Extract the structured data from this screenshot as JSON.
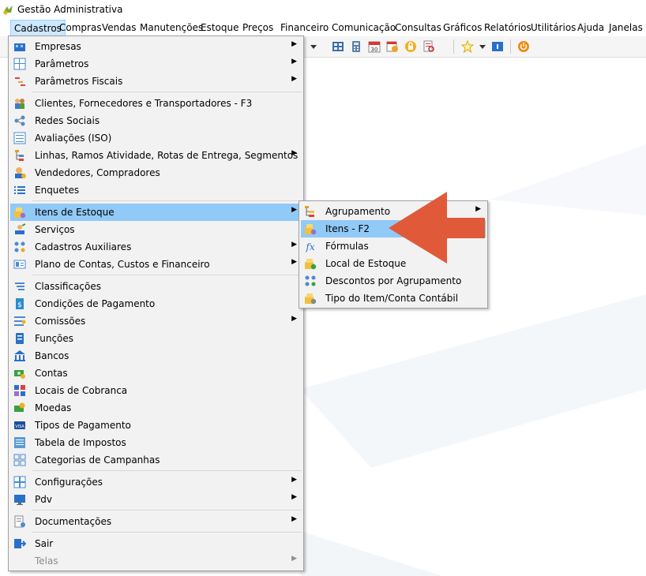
{
  "window": {
    "title": "Gestão Administrativa"
  },
  "menubar": [
    "Cadastros",
    "Compras",
    "Vendas",
    "Manutenções",
    "Estoque",
    "Preços",
    "Financeiro",
    "Comunicação",
    "Consultas",
    "Gráficos",
    "Relatórios",
    "Utilitários",
    "Ajuda",
    "Janelas"
  ],
  "main_menu": {
    "groups": [
      [
        {
          "label": "Empresas",
          "icon": "company-icon",
          "submenu": true
        },
        {
          "label": "Parâmetros",
          "icon": "parameters-icon",
          "submenu": true
        },
        {
          "label": "Parâmetros Fiscais",
          "icon": "fiscal-parameters-icon",
          "submenu": true
        }
      ],
      [
        {
          "label": "Clientes, Fornecedores e Transportadores - F3",
          "icon": "people-icon",
          "submenu": false
        },
        {
          "label": "Redes Sociais",
          "icon": "social-network-icon",
          "submenu": false
        },
        {
          "label": "Avaliações (ISO)",
          "icon": "evaluation-icon",
          "submenu": false
        },
        {
          "label": "Linhas, Ramos Atividade, Rotas de Entrega, Segmentos",
          "icon": "tree-icon",
          "submenu": true
        },
        {
          "label": "Vendedores, Compradores",
          "icon": "seller-icon",
          "submenu": false
        },
        {
          "label": "Enquetes",
          "icon": "list-icon",
          "submenu": false
        }
      ],
      [
        {
          "label": "Itens de Estoque",
          "icon": "stock-items-icon",
          "submenu": true,
          "highlighted": true
        },
        {
          "label": "Serviços",
          "icon": "services-icon",
          "submenu": false
        },
        {
          "label": "Cadastros Auxiliares",
          "icon": "auxiliary-icon",
          "submenu": true
        },
        {
          "label": "Plano de Contas, Custos e Financeiro",
          "icon": "accounts-plan-icon",
          "submenu": true
        }
      ],
      [
        {
          "label": "Classificações",
          "icon": "classification-icon",
          "submenu": false
        },
        {
          "label": "Condições de Pagamento",
          "icon": "payment-conditions-icon",
          "submenu": false
        },
        {
          "label": "Comissões",
          "icon": "commission-icon",
          "submenu": true
        },
        {
          "label": "Funções",
          "icon": "functions-icon",
          "submenu": false
        },
        {
          "label": "Bancos",
          "icon": "bank-icon",
          "submenu": false
        },
        {
          "label": "Contas",
          "icon": "money-icon",
          "submenu": false
        },
        {
          "label": "Locais de Cobranca",
          "icon": "billing-places-icon",
          "submenu": false
        },
        {
          "label": "Moedas",
          "icon": "coins-icon",
          "submenu": false
        },
        {
          "label": "Tipos de Pagamento",
          "icon": "card-icon",
          "submenu": false
        },
        {
          "label": "Tabela de Impostos",
          "icon": "tax-table-icon",
          "submenu": false
        },
        {
          "label": "Categorias de Campanhas",
          "icon": "categories-icon",
          "submenu": false
        }
      ],
      [
        {
          "label": "Configurações",
          "icon": "settings-icon",
          "submenu": true
        },
        {
          "label": "Pdv",
          "icon": "monitor-icon",
          "submenu": true
        }
      ],
      [
        {
          "label": "Documentações",
          "icon": "documents-icon",
          "submenu": true
        }
      ],
      [
        {
          "label": "Sair",
          "icon": "exit-icon",
          "submenu": false
        },
        {
          "label": "Telas",
          "icon": "",
          "submenu": true,
          "disabled": true
        }
      ]
    ]
  },
  "sub_menu": [
    {
      "label": "Agrupamento",
      "icon": "grouping-icon",
      "submenu": true
    },
    {
      "label": "Itens - F2",
      "icon": "stock-items-icon",
      "submenu": false,
      "highlighted": true
    },
    {
      "label": "Fórmulas",
      "icon": "formula-icon",
      "submenu": false
    },
    {
      "label": "Local de Estoque",
      "icon": "stock-location-icon",
      "submenu": false
    },
    {
      "label": "Descontos por Agrupamento",
      "icon": "discount-icon",
      "submenu": false
    },
    {
      "label": "Tipo do Item/Conta Contábil",
      "icon": "item-type-icon",
      "submenu": false
    }
  ],
  "colors": {
    "highlight": "#91c9f7",
    "menu_bg": "#f2f2f2",
    "arrow": "#e05a3a"
  }
}
